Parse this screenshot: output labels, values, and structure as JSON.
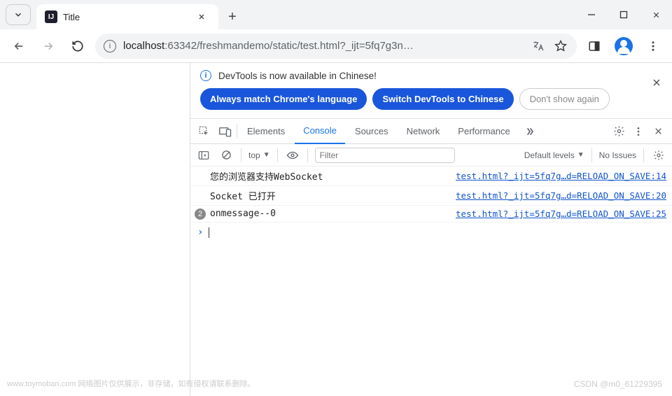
{
  "titlebar": {
    "tab_title": "Title",
    "favicon_text": "IJ"
  },
  "toolbar": {
    "url_host": "localhost",
    "url_port_path": ":63342/freshmandemo/static/test.html?_ijt=5fq7g3n…"
  },
  "banner": {
    "message": "DevTools is now available in Chinese!",
    "btn_match": "Always match Chrome's language",
    "btn_switch": "Switch DevTools to Chinese",
    "btn_dismiss": "Don't show again"
  },
  "devtools_tabs": {
    "elements": "Elements",
    "console": "Console",
    "sources": "Sources",
    "network": "Network",
    "performance": "Performance"
  },
  "console_toolbar": {
    "context": "top",
    "filter_placeholder": "Filter",
    "levels": "Default levels",
    "issues": "No Issues"
  },
  "console_logs": [
    {
      "badge": null,
      "message": "您的浏览器支持WebSocket",
      "source": "test.html?_ijt=5fq7g…d=RELOAD_ON_SAVE:14"
    },
    {
      "badge": null,
      "message": "Socket 已打开",
      "source": "test.html?_ijt=5fq7g…d=RELOAD_ON_SAVE:20"
    },
    {
      "badge": "2",
      "message": "onmessage--0",
      "source": "test.html?_ijt=5fq7g…d=RELOAD_ON_SAVE:25"
    }
  ],
  "watermark": {
    "left": "www.toymoban.com 网络图片仅供展示，非存储，如有侵权请联系删除。",
    "right": "CSDN @m0_61229395"
  }
}
